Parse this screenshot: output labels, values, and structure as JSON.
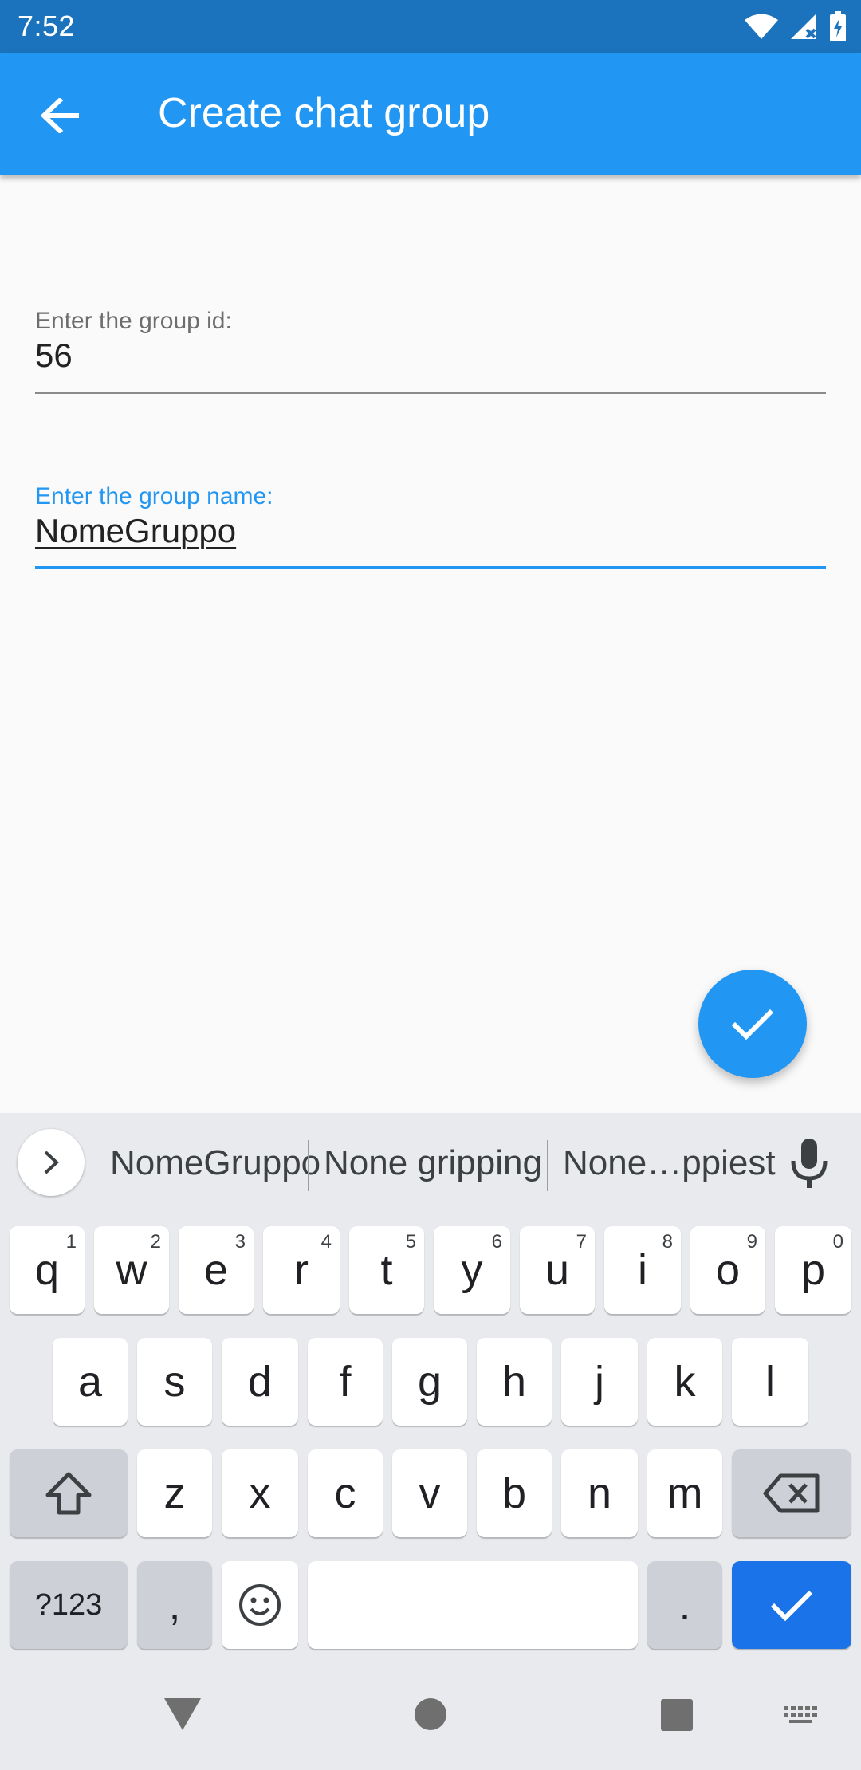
{
  "status_bar": {
    "time": "7:52"
  },
  "app_bar": {
    "title": "Create chat group"
  },
  "form": {
    "group_id": {
      "label": "Enter the group id:",
      "value": "56"
    },
    "group_name": {
      "label": "Enter the group name:",
      "value": "NomeGruppo"
    }
  },
  "keyboard": {
    "suggestions": [
      "NomeGruppo",
      "None gripping",
      "None…ppiest"
    ],
    "row1": [
      {
        "key": "q",
        "hint": "1"
      },
      {
        "key": "w",
        "hint": "2"
      },
      {
        "key": "e",
        "hint": "3"
      },
      {
        "key": "r",
        "hint": "4"
      },
      {
        "key": "t",
        "hint": "5"
      },
      {
        "key": "y",
        "hint": "6"
      },
      {
        "key": "u",
        "hint": "7"
      },
      {
        "key": "i",
        "hint": "8"
      },
      {
        "key": "o",
        "hint": "9"
      },
      {
        "key": "p",
        "hint": "0"
      }
    ],
    "row2": [
      "a",
      "s",
      "d",
      "f",
      "g",
      "h",
      "j",
      "k",
      "l"
    ],
    "row3": [
      "z",
      "x",
      "c",
      "v",
      "b",
      "n",
      "m"
    ],
    "symbols_label": "?123",
    "comma": ",",
    "period": "."
  },
  "colors": {
    "primary": "#2196f3",
    "status_bar": "#1b73be",
    "keyboard_enter": "#1a73e8"
  }
}
